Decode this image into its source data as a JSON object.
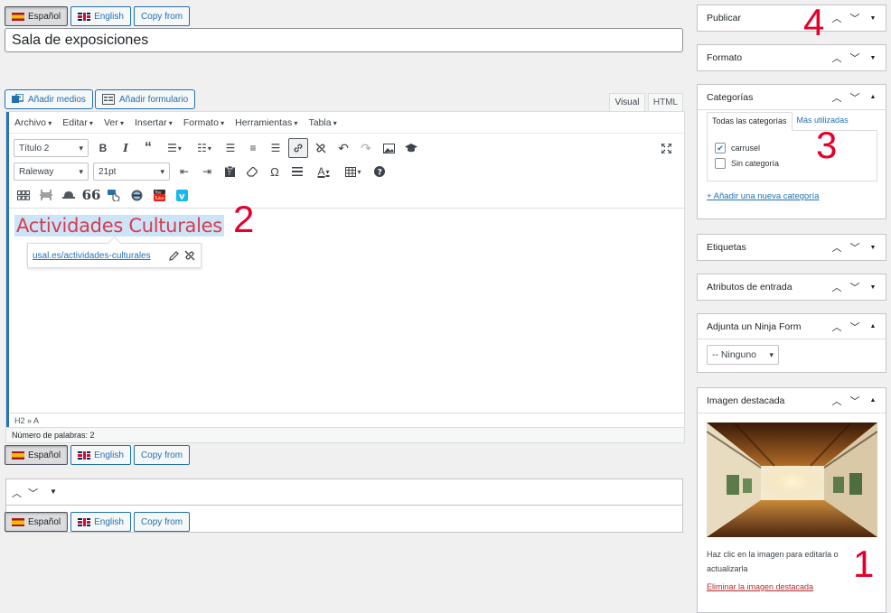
{
  "lang_bar": {
    "spanish": "Español",
    "english": "English",
    "copy_from": "Copy from"
  },
  "post_title": "Sala de exposiciones",
  "media": {
    "add_media": "Añadir medios",
    "add_form": "Añadir formulario"
  },
  "editor_tabs": {
    "visual": "Visual",
    "html": "HTML"
  },
  "menus": [
    "Archivo",
    "Editar",
    "Ver",
    "Insertar",
    "Formato",
    "Herramientas",
    "Tabla"
  ],
  "toolbar": {
    "block_format": "Título 2",
    "font_family": "Raleway",
    "font_size": "21pt"
  },
  "content": {
    "heading": "Actividades Culturales",
    "link_url": "usal.es/actividades-culturales"
  },
  "status": {
    "path": "H2 » A",
    "word_count": "Número de palabras: 2"
  },
  "sidebar": {
    "publish": "Publicar",
    "format": "Formato",
    "categories": {
      "title": "Categorías",
      "tab_all": "Todas las categorías",
      "tab_popular": "Más utilizadas",
      "items": [
        {
          "label": "carrusel",
          "checked": true
        },
        {
          "label": "Sin categoría",
          "checked": false
        }
      ],
      "add_new": "+ Añadir una nueva categoría"
    },
    "tags": "Etiquetas",
    "attributes": "Atributos de entrada",
    "ninja": {
      "title": "Adjunta un Ninja Form",
      "selected": "-- Ninguno"
    },
    "featured": {
      "title": "Imagen destacada",
      "hint": "Haz clic en la imagen para editarla o actualizarla",
      "remove": "Eliminar la imagen destacada"
    }
  },
  "annotations": {
    "n1": "1",
    "n2": "2",
    "n3": "3",
    "n4": "4"
  },
  "colors": {
    "accent": "#2271b1",
    "heading_text": "#d63d4f",
    "annotation": "#e4002b"
  }
}
